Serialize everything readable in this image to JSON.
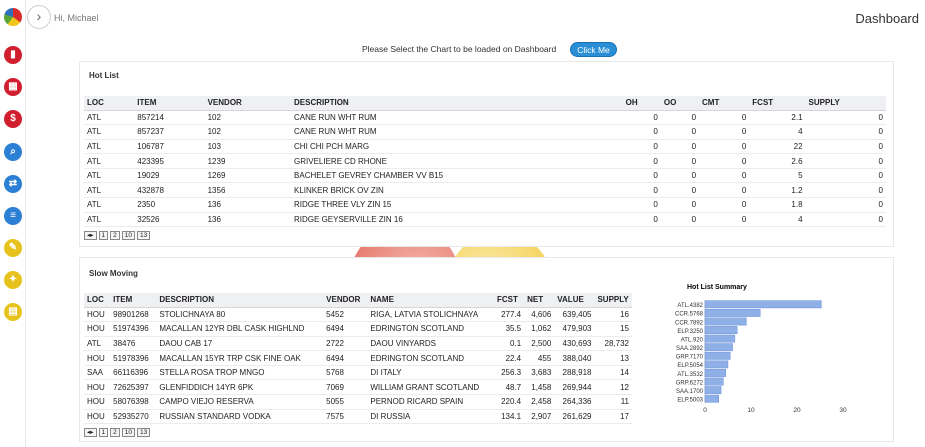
{
  "header": {
    "greeting": "Hi, Michael",
    "title": "Dashboard"
  },
  "prompt": {
    "text": "Please Select the Chart to be loaded on Dashboard",
    "button": "Click Me"
  },
  "rail": {
    "icons": [
      "bar-chart-icon",
      "calendar-icon",
      "dollar-icon",
      "search-icon",
      "swap-icon",
      "document-icon",
      "pencil-icon",
      "wrench-icon",
      "note-icon"
    ]
  },
  "hot_list": {
    "title": "Hot List",
    "columns": [
      "LOC",
      "ITEM",
      "VENDOR",
      "DESCRIPTION",
      "OH",
      "OO",
      "CMT",
      "FCST",
      "SUPPLY"
    ],
    "rows": [
      [
        "ATL",
        "857214",
        "102",
        "CANE RUN WHT RUM",
        "0",
        "0",
        "0",
        "2.1",
        "0"
      ],
      [
        "ATL",
        "857237",
        "102",
        "CANE RUN WHT RUM",
        "0",
        "0",
        "0",
        "4",
        "0"
      ],
      [
        "ATL",
        "106787",
        "103",
        "CHI CHI PCH MARG",
        "0",
        "0",
        "0",
        "22",
        "0"
      ],
      [
        "ATL",
        "423395",
        "1239",
        "GRIVELIERE CD RHONE",
        "0",
        "0",
        "0",
        "2.6",
        "0"
      ],
      [
        "ATL",
        "19029",
        "1269",
        "BACHELET GEVREY CHAMBER VV B15",
        "0",
        "0",
        "0",
        "5",
        "0"
      ],
      [
        "ATL",
        "432878",
        "1356",
        "KLINKER BRICK OV ZIN",
        "0",
        "0",
        "0",
        "1.2",
        "0"
      ],
      [
        "ATL",
        "2350",
        "136",
        "RIDGE THREE VLY ZIN 15",
        "0",
        "0",
        "0",
        "1.8",
        "0"
      ],
      [
        "ATL",
        "32526",
        "136",
        "RIDGE GEYSERVILLE ZIN 16",
        "0",
        "0",
        "0",
        "4",
        "0"
      ]
    ],
    "pager": [
      "1",
      "2",
      "10",
      "13"
    ]
  },
  "slow_moving": {
    "title": "Slow Moving",
    "columns": [
      "LOC",
      "ITEM",
      "DESCRIPTION",
      "VENDOR",
      "NAME",
      "FCST",
      "NET",
      "VALUE",
      "SUPPLY"
    ],
    "rows": [
      [
        "HOU",
        "98901268",
        "STOLICHNAYA 80",
        "5452",
        "RIGA, LATVIA STOLICHNAYA",
        "277.4",
        "4,606",
        "639,405",
        "16"
      ],
      [
        "HOU",
        "51974396",
        "MACALLAN 12YR DBL CASK HIGHLND",
        "6494",
        "EDRINGTON SCOTLAND",
        "35.5",
        "1,062",
        "479,903",
        "15"
      ],
      [
        "ATL",
        "38476",
        "DAOU CAB 17",
        "2722",
        "DAOU VINYARDS",
        "0.1",
        "2,500",
        "430,693",
        "28,732"
      ],
      [
        "HOU",
        "51978396",
        "MACALLAN 15YR TRP CSK FINE OAK",
        "6494",
        "EDRINGTON SCOTLAND",
        "22.4",
        "455",
        "388,040",
        "13"
      ],
      [
        "SAA",
        "66116396",
        "STELLA ROSA TROP MNGO",
        "5768",
        "DI ITALY",
        "256.3",
        "3,683",
        "288,918",
        "14"
      ],
      [
        "HOU",
        "72625397",
        "GLENFIDDICH 14YR 6PK",
        "7069",
        "WILLIAM GRANT SCOTLAND",
        "48.7",
        "1,458",
        "269,944",
        "12"
      ],
      [
        "HOU",
        "58076398",
        "CAMPO VIEJO RESERVA",
        "5055",
        "PERNOD RICARD SPAIN",
        "220.4",
        "2,458",
        "264,336",
        "11"
      ],
      [
        "HOU",
        "52935270",
        "RUSSIAN STANDARD VODKA",
        "7575",
        "DI RUSSIA",
        "134.1",
        "2,907",
        "261,629",
        "17"
      ]
    ],
    "pager": [
      "1",
      "2",
      "10",
      "13"
    ]
  },
  "chart_data": {
    "type": "bar",
    "orientation": "horizontal",
    "title": "Hot List Summary",
    "categories": [
      "ATL.4382",
      "CCR.5768",
      "CCR.7892",
      "ELP.3250",
      "ATL.920",
      "SAA.2892",
      "GRP.7170",
      "ELP.5054",
      "ATL.3532",
      "GRP.6272",
      "SAA.1700",
      "ELP.5003"
    ],
    "values": [
      25.3,
      12,
      9,
      7,
      6.5,
      6,
      5.5,
      5,
      4.5,
      4,
      3.5,
      3
    ],
    "x_ticks": [
      "0",
      "10",
      "20",
      "30"
    ],
    "xlim": [
      0,
      30
    ],
    "color": "#8fb0e6",
    "edge_color": "#5b86d6"
  }
}
